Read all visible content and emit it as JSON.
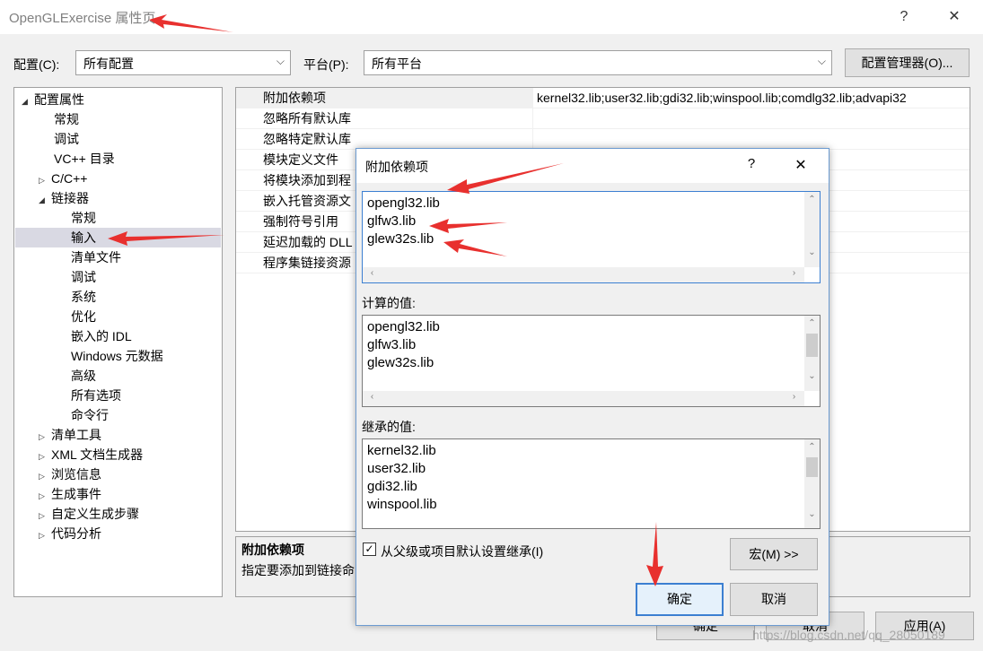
{
  "window": {
    "title": "OpenGLExercise 属性页",
    "help_glyph": "?",
    "close_glyph": "✕"
  },
  "config_row": {
    "config_label": "配置(C):",
    "config_value": "所有配置",
    "platform_label": "平台(P):",
    "platform_value": "所有平台",
    "manager_button": "配置管理器(O)..."
  },
  "tree": {
    "items": [
      {
        "label": "配置属性",
        "toggle": "◢"
      },
      {
        "label": "常规",
        "toggle": ""
      },
      {
        "label": "调试",
        "toggle": ""
      },
      {
        "label": "VC++ 目录",
        "toggle": ""
      },
      {
        "label": "C/C++",
        "toggle": "▷"
      },
      {
        "label": "链接器",
        "toggle": "◢"
      },
      {
        "label": "常规",
        "toggle": ""
      },
      {
        "label": "输入",
        "toggle": ""
      },
      {
        "label": "清单文件",
        "toggle": ""
      },
      {
        "label": "调试",
        "toggle": ""
      },
      {
        "label": "系统",
        "toggle": ""
      },
      {
        "label": "优化",
        "toggle": ""
      },
      {
        "label": "嵌入的 IDL",
        "toggle": ""
      },
      {
        "label": "Windows 元数据",
        "toggle": ""
      },
      {
        "label": "高级",
        "toggle": ""
      },
      {
        "label": "所有选项",
        "toggle": ""
      },
      {
        "label": "命令行",
        "toggle": ""
      },
      {
        "label": "清单工具",
        "toggle": "▷"
      },
      {
        "label": "XML 文档生成器",
        "toggle": "▷"
      },
      {
        "label": "浏览信息",
        "toggle": "▷"
      },
      {
        "label": "生成事件",
        "toggle": "▷"
      },
      {
        "label": "自定义生成步骤",
        "toggle": "▷"
      },
      {
        "label": "代码分析",
        "toggle": "▷"
      }
    ]
  },
  "grid": {
    "rows": [
      {
        "name": "附加依赖项",
        "value": "kernel32.lib;user32.lib;gdi32.lib;winspool.lib;comdlg32.lib;advapi32"
      },
      {
        "name": "忽略所有默认库",
        "value": ""
      },
      {
        "name": "忽略特定默认库",
        "value": ""
      },
      {
        "name": "模块定义文件",
        "value": ""
      },
      {
        "name": "将模块添加到程",
        "value": ""
      },
      {
        "name": "嵌入托管资源文",
        "value": ""
      },
      {
        "name": "强制符号引用",
        "value": ""
      },
      {
        "name": "延迟加载的 DLL",
        "value": ""
      },
      {
        "name": "程序集链接资源",
        "value": ""
      }
    ],
    "desc_title": "附加依赖项",
    "desc_text": "指定要添加到链接命"
  },
  "dialog": {
    "title": "附加依赖项",
    "help_glyph": "?",
    "close_glyph": "✕",
    "input_lines": [
      "opengl32.lib",
      "glfw3.lib",
      "glew32s.lib"
    ],
    "computed_label": "计算的值:",
    "computed_lines": [
      "opengl32.lib",
      "glfw3.lib",
      "glew32s.lib"
    ],
    "inherited_label": "继承的值:",
    "inherited_lines": [
      "kernel32.lib",
      "user32.lib",
      "gdi32.lib",
      "winspool.lib"
    ],
    "inherit_checkbox": "从父级或项目默认设置继承(I)",
    "inherit_checked": true,
    "macro_button": "宏(M) >>",
    "ok_button": "确定",
    "cancel_button": "取消"
  },
  "bottom_buttons": {
    "ok": "确定",
    "cancel": "取消",
    "apply": "应用(A)"
  },
  "watermark": "https://blog.csdn.net/qq_28050189",
  "colors": {
    "selection": "#d9d9e3",
    "arrow": "#e8302e",
    "focus_border": "#3c7fd1"
  }
}
